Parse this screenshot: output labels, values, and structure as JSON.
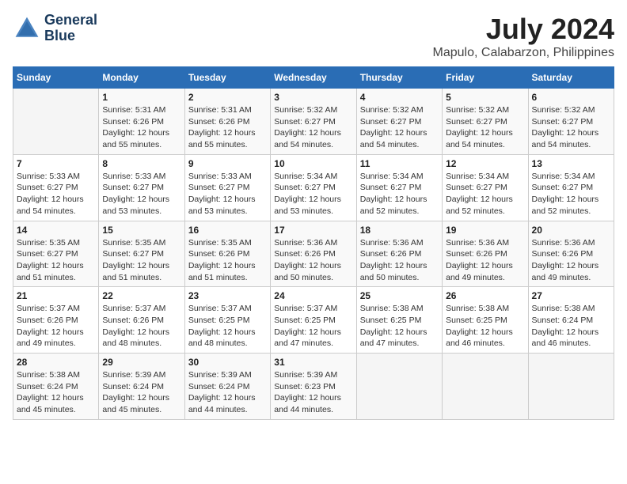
{
  "logo": {
    "line1": "General",
    "line2": "Blue"
  },
  "title": "July 2024",
  "subtitle": "Mapulo, Calabarzon, Philippines",
  "days_header": [
    "Sunday",
    "Monday",
    "Tuesday",
    "Wednesday",
    "Thursday",
    "Friday",
    "Saturday"
  ],
  "weeks": [
    [
      {
        "day": "",
        "info": ""
      },
      {
        "day": "1",
        "info": "Sunrise: 5:31 AM\nSunset: 6:26 PM\nDaylight: 12 hours\nand 55 minutes."
      },
      {
        "day": "2",
        "info": "Sunrise: 5:31 AM\nSunset: 6:26 PM\nDaylight: 12 hours\nand 55 minutes."
      },
      {
        "day": "3",
        "info": "Sunrise: 5:32 AM\nSunset: 6:27 PM\nDaylight: 12 hours\nand 54 minutes."
      },
      {
        "day": "4",
        "info": "Sunrise: 5:32 AM\nSunset: 6:27 PM\nDaylight: 12 hours\nand 54 minutes."
      },
      {
        "day": "5",
        "info": "Sunrise: 5:32 AM\nSunset: 6:27 PM\nDaylight: 12 hours\nand 54 minutes."
      },
      {
        "day": "6",
        "info": "Sunrise: 5:32 AM\nSunset: 6:27 PM\nDaylight: 12 hours\nand 54 minutes."
      }
    ],
    [
      {
        "day": "7",
        "info": "Sunrise: 5:33 AM\nSunset: 6:27 PM\nDaylight: 12 hours\nand 54 minutes."
      },
      {
        "day": "8",
        "info": "Sunrise: 5:33 AM\nSunset: 6:27 PM\nDaylight: 12 hours\nand 53 minutes."
      },
      {
        "day": "9",
        "info": "Sunrise: 5:33 AM\nSunset: 6:27 PM\nDaylight: 12 hours\nand 53 minutes."
      },
      {
        "day": "10",
        "info": "Sunrise: 5:34 AM\nSunset: 6:27 PM\nDaylight: 12 hours\nand 53 minutes."
      },
      {
        "day": "11",
        "info": "Sunrise: 5:34 AM\nSunset: 6:27 PM\nDaylight: 12 hours\nand 52 minutes."
      },
      {
        "day": "12",
        "info": "Sunrise: 5:34 AM\nSunset: 6:27 PM\nDaylight: 12 hours\nand 52 minutes."
      },
      {
        "day": "13",
        "info": "Sunrise: 5:34 AM\nSunset: 6:27 PM\nDaylight: 12 hours\nand 52 minutes."
      }
    ],
    [
      {
        "day": "14",
        "info": "Sunrise: 5:35 AM\nSunset: 6:27 PM\nDaylight: 12 hours\nand 51 minutes."
      },
      {
        "day": "15",
        "info": "Sunrise: 5:35 AM\nSunset: 6:27 PM\nDaylight: 12 hours\nand 51 minutes."
      },
      {
        "day": "16",
        "info": "Sunrise: 5:35 AM\nSunset: 6:26 PM\nDaylight: 12 hours\nand 51 minutes."
      },
      {
        "day": "17",
        "info": "Sunrise: 5:36 AM\nSunset: 6:26 PM\nDaylight: 12 hours\nand 50 minutes."
      },
      {
        "day": "18",
        "info": "Sunrise: 5:36 AM\nSunset: 6:26 PM\nDaylight: 12 hours\nand 50 minutes."
      },
      {
        "day": "19",
        "info": "Sunrise: 5:36 AM\nSunset: 6:26 PM\nDaylight: 12 hours\nand 49 minutes."
      },
      {
        "day": "20",
        "info": "Sunrise: 5:36 AM\nSunset: 6:26 PM\nDaylight: 12 hours\nand 49 minutes."
      }
    ],
    [
      {
        "day": "21",
        "info": "Sunrise: 5:37 AM\nSunset: 6:26 PM\nDaylight: 12 hours\nand 49 minutes."
      },
      {
        "day": "22",
        "info": "Sunrise: 5:37 AM\nSunset: 6:26 PM\nDaylight: 12 hours\nand 48 minutes."
      },
      {
        "day": "23",
        "info": "Sunrise: 5:37 AM\nSunset: 6:25 PM\nDaylight: 12 hours\nand 48 minutes."
      },
      {
        "day": "24",
        "info": "Sunrise: 5:37 AM\nSunset: 6:25 PM\nDaylight: 12 hours\nand 47 minutes."
      },
      {
        "day": "25",
        "info": "Sunrise: 5:38 AM\nSunset: 6:25 PM\nDaylight: 12 hours\nand 47 minutes."
      },
      {
        "day": "26",
        "info": "Sunrise: 5:38 AM\nSunset: 6:25 PM\nDaylight: 12 hours\nand 46 minutes."
      },
      {
        "day": "27",
        "info": "Sunrise: 5:38 AM\nSunset: 6:24 PM\nDaylight: 12 hours\nand 46 minutes."
      }
    ],
    [
      {
        "day": "28",
        "info": "Sunrise: 5:38 AM\nSunset: 6:24 PM\nDaylight: 12 hours\nand 45 minutes."
      },
      {
        "day": "29",
        "info": "Sunrise: 5:39 AM\nSunset: 6:24 PM\nDaylight: 12 hours\nand 45 minutes."
      },
      {
        "day": "30",
        "info": "Sunrise: 5:39 AM\nSunset: 6:24 PM\nDaylight: 12 hours\nand 44 minutes."
      },
      {
        "day": "31",
        "info": "Sunrise: 5:39 AM\nSunset: 6:23 PM\nDaylight: 12 hours\nand 44 minutes."
      },
      {
        "day": "",
        "info": ""
      },
      {
        "day": "",
        "info": ""
      },
      {
        "day": "",
        "info": ""
      }
    ]
  ]
}
